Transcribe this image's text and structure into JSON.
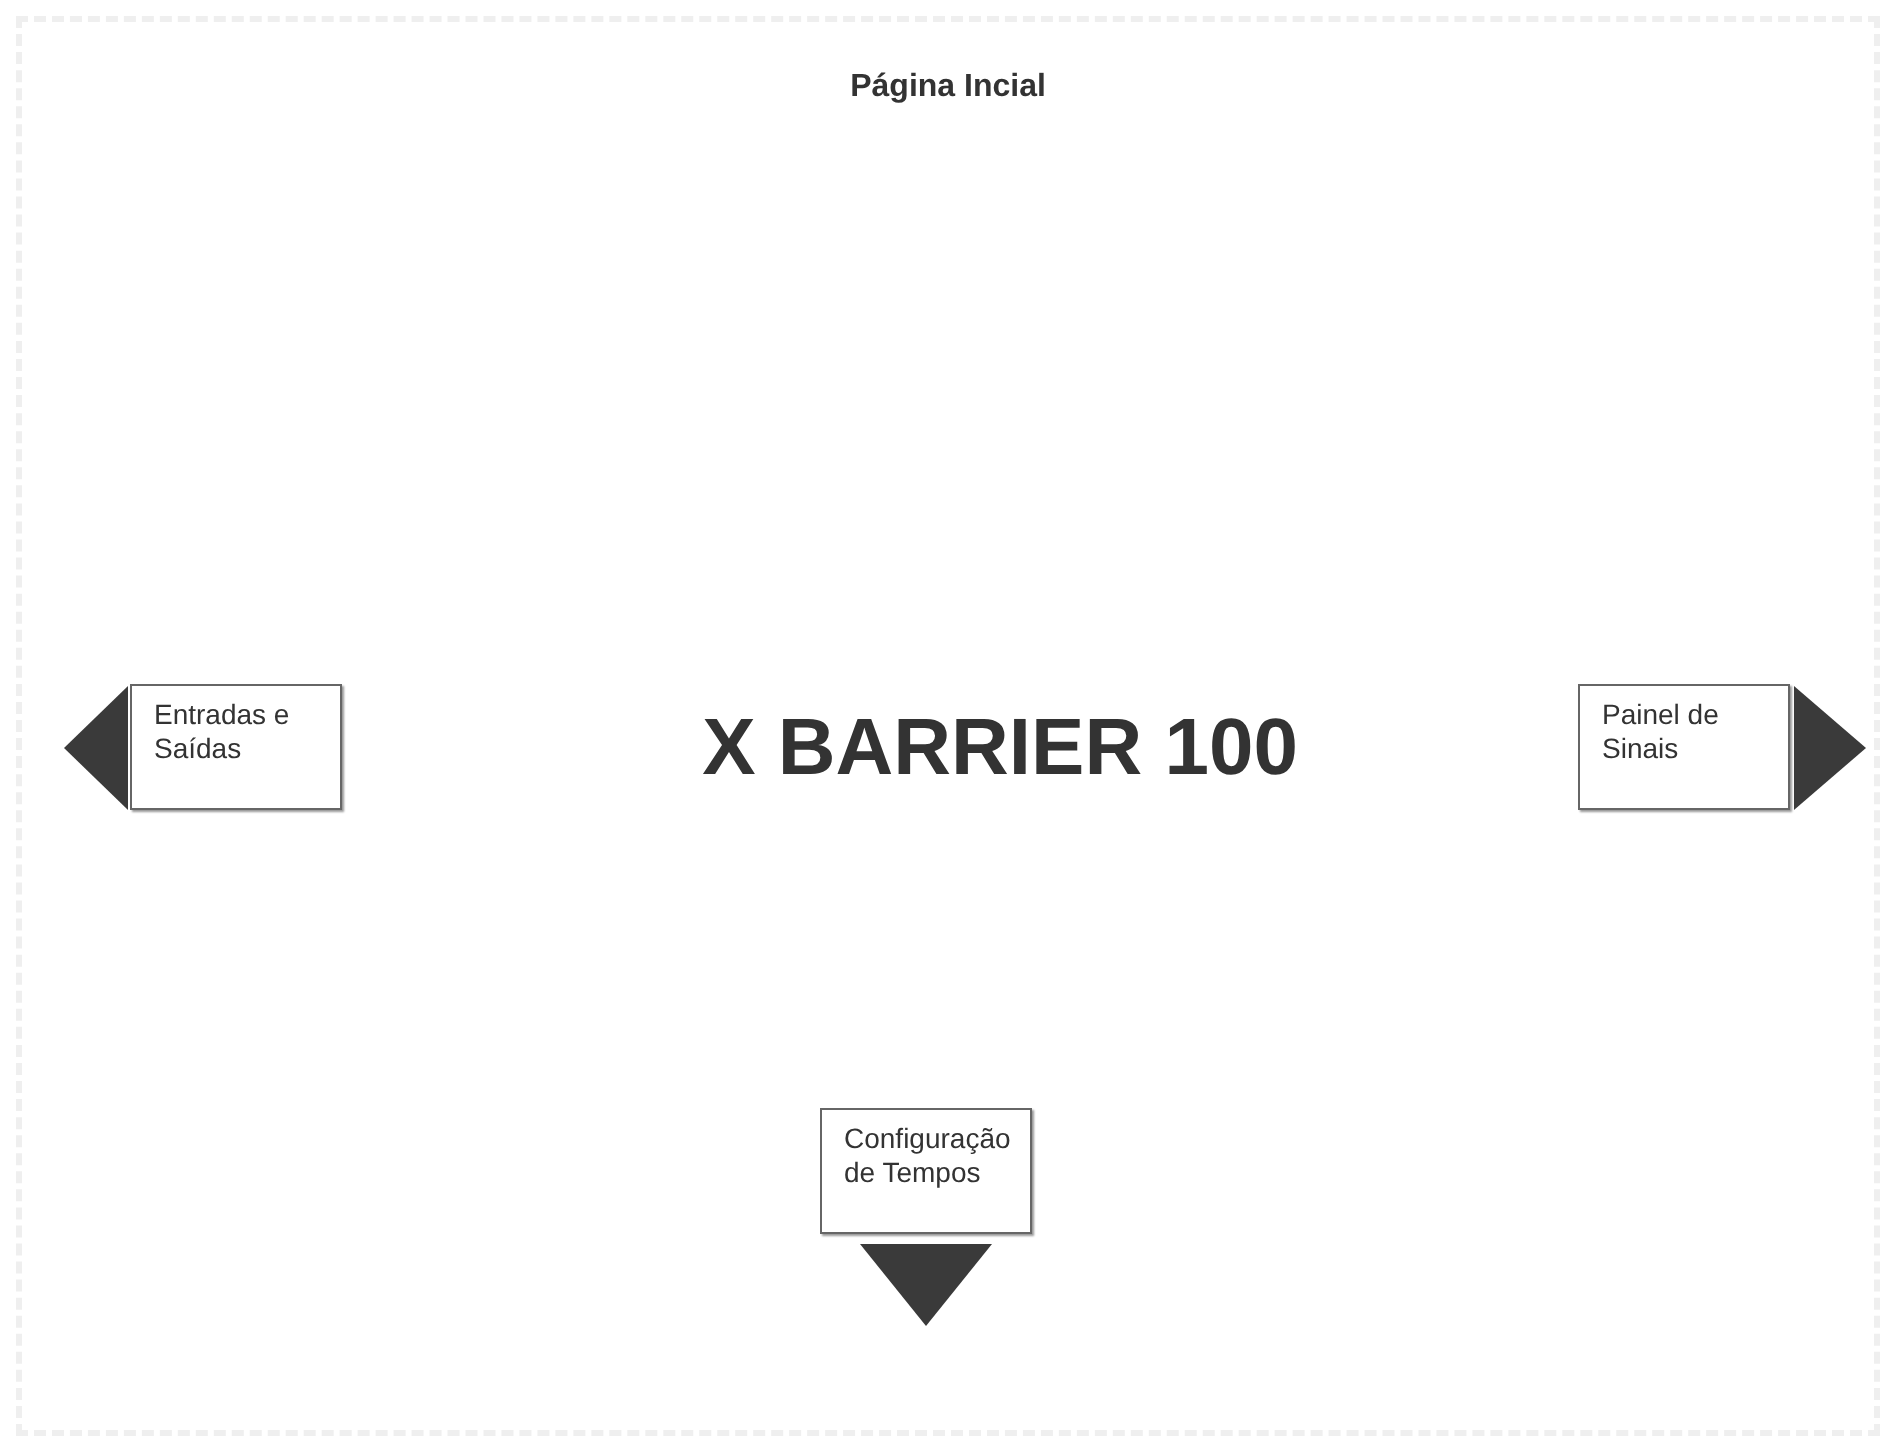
{
  "page": {
    "title": "Página Incial",
    "product_name": "X BARRIER 100"
  },
  "nav_buttons": [
    {
      "kind": "left",
      "label": "Entradas e Saídas"
    },
    {
      "kind": "right",
      "label": "Painel de Sinais"
    },
    {
      "kind": "down",
      "label": "Configuração de Tempos"
    }
  ]
}
